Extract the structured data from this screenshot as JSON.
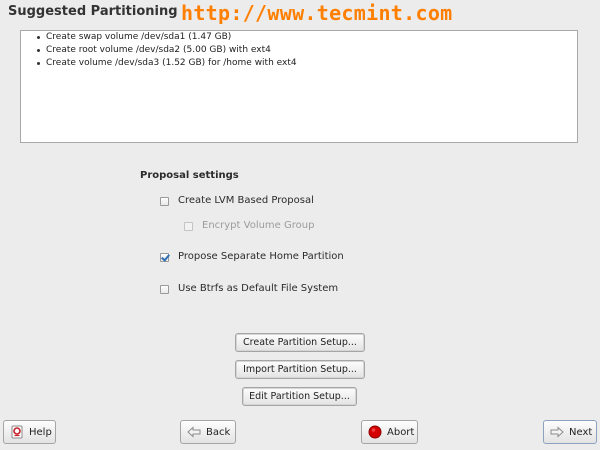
{
  "header": {
    "title": "Suggested Partitioning",
    "watermark": "http://www.tecmint.com"
  },
  "summary": {
    "items": [
      "Create swap volume /dev/sda1 (1.47 GB)",
      "Create root volume /dev/sda2 (5.00 GB) with ext4",
      "Create volume /dev/sda3 (1.52 GB) for /home with ext4"
    ]
  },
  "proposal": {
    "title": "Proposal settings",
    "options": [
      {
        "label": "Create LVM Based Proposal",
        "checked": false,
        "enabled": true
      },
      {
        "label": "Encrypt Volume Group",
        "checked": false,
        "enabled": false
      },
      {
        "label": "Propose Separate Home Partition",
        "checked": true,
        "enabled": true
      },
      {
        "label": "Use Btrfs as Default File System",
        "checked": false,
        "enabled": true
      }
    ]
  },
  "actions": {
    "create": "Create Partition Setup...",
    "import": "Import Partition Setup...",
    "edit": "Edit Partition Setup..."
  },
  "footer": {
    "help": "Help",
    "back": "Back",
    "abort": "Abort",
    "next": "Next"
  },
  "colors": {
    "watermark": "#ff7f00",
    "abort_icon": "#d40000",
    "check_accent": "#2f6fb3"
  }
}
